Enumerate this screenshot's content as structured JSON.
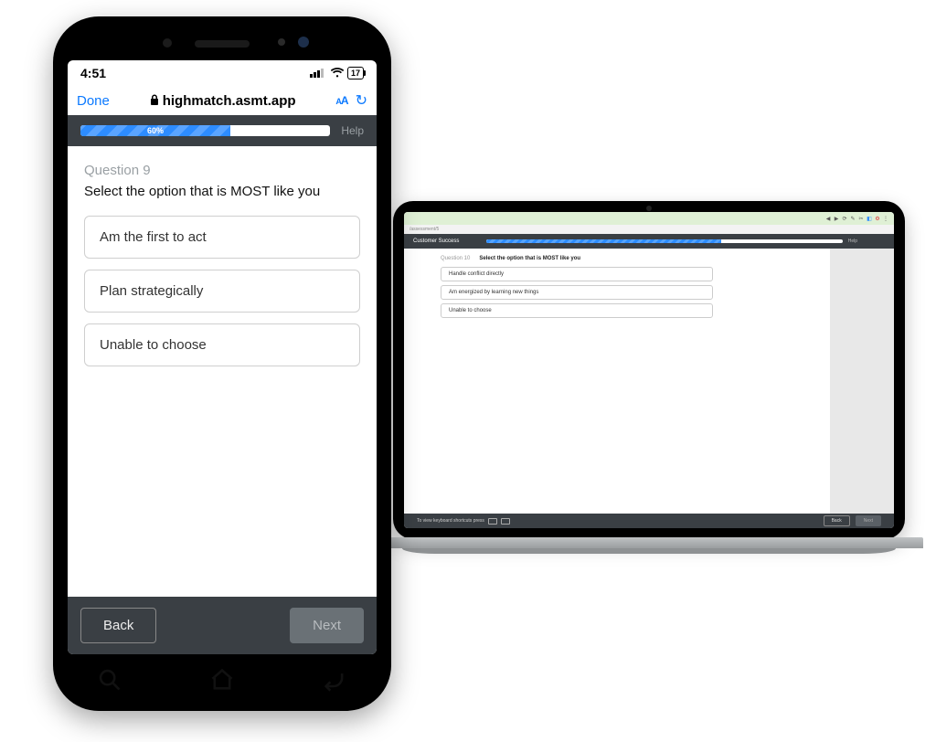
{
  "phone": {
    "status": {
      "time": "4:51",
      "battery": "17"
    },
    "safari": {
      "done": "Done",
      "url": "highmatch.asmt.app",
      "aa": "AA"
    },
    "app": {
      "progress_label": "60%",
      "help": "Help",
      "question_number": "Question 9",
      "question_text": "Select the option that is MOST like you",
      "options": [
        "Am the first to act",
        "Plan strategically",
        "Unable to choose"
      ],
      "back": "Back",
      "next": "Next"
    }
  },
  "laptop": {
    "url_fragment": "/assessment/5",
    "title": "Customer Success",
    "progress_label": "66%",
    "help": "Help",
    "question_number": "Question 10",
    "question_text": "Select the option that is MOST like you",
    "options": [
      "Handle conflict directly",
      "Am energized by learning new things",
      "Unable to choose"
    ],
    "footer_hint": "To view keyboard shortcuts press",
    "back": "Back",
    "next": "Next"
  }
}
